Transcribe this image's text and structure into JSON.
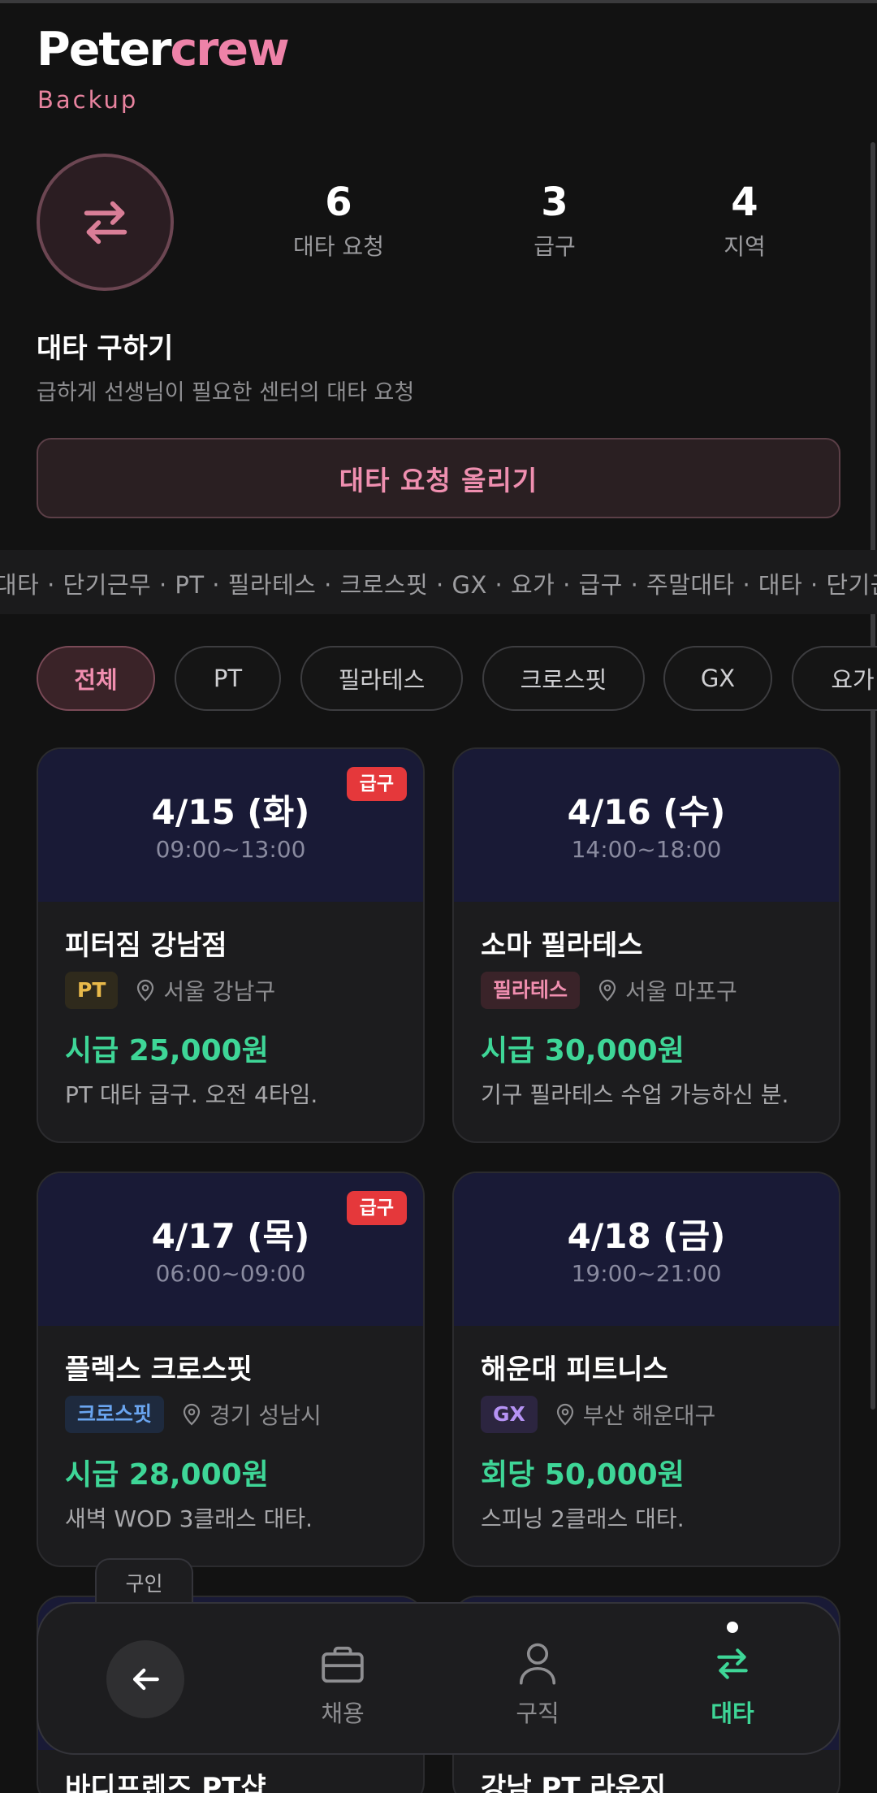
{
  "brand": {
    "part1": "Peter",
    "part2": "crew",
    "subtitle": "Backup"
  },
  "colors": {
    "accent_pink": "#ee82a8",
    "accent_green": "#3ed697",
    "urgent_red": "#e5383b",
    "card_header": "#191a36"
  },
  "stats": [
    {
      "value": "6",
      "label": "대타 요청"
    },
    {
      "value": "3",
      "label": "급구"
    },
    {
      "value": "4",
      "label": "지역"
    }
  ],
  "section": {
    "title": "대타 구하기",
    "description": "급하게 선생님이 필요한 센터의 대타 요청"
  },
  "cta_label": "대타 요청 올리기",
  "ticker_text": "대타 · 단기근무 · PT · 필라테스 · 크로스핏 · GX · 요가 · 급구 · 주말대타 · 대타 · 단기근무",
  "filters": [
    {
      "label": "전체",
      "active": true
    },
    {
      "label": "PT",
      "active": false
    },
    {
      "label": "필라테스",
      "active": false
    },
    {
      "label": "크로스핏",
      "active": false
    },
    {
      "label": "GX",
      "active": false
    },
    {
      "label": "요가",
      "active": false
    }
  ],
  "cards": [
    {
      "date": "4/15 (화)",
      "time": "09:00~13:00",
      "badge": "급구",
      "name": "피터짐 강남점",
      "tag": "PT",
      "location": "서울 강남구",
      "pay": "시급 25,000원",
      "desc": "PT 대타 급구. 오전 4타임."
    },
    {
      "date": "4/16 (수)",
      "time": "14:00~18:00",
      "badge": "",
      "name": "소마 필라테스",
      "tag": "필라테스",
      "location": "서울 마포구",
      "pay": "시급 30,000원",
      "desc": "기구 필라테스 수업 가능하신 분."
    },
    {
      "date": "4/17 (목)",
      "time": "06:00~09:00",
      "badge": "급구",
      "name": "플렉스 크로스핏",
      "tag": "크로스핏",
      "location": "경기 성남시",
      "pay": "시급 28,000원",
      "desc": "새벽 WOD 3클래스 대타."
    },
    {
      "date": "4/18 (금)",
      "time": "19:00~21:00",
      "badge": "",
      "name": "해운대 피트니스",
      "tag": "GX",
      "location": "부산 해운대구",
      "pay": "회당 50,000원",
      "desc": "스피닝 2클래스 대타."
    },
    {
      "name": "바디프렌즈 PT샵"
    },
    {
      "name": "강남 PT 라운지"
    }
  ],
  "bottom_nav": {
    "floating_tab": "구인",
    "items": [
      {
        "label": "채용",
        "icon": "briefcase-icon"
      },
      {
        "label": "구직",
        "icon": "person-icon"
      },
      {
        "label": "대타",
        "icon": "swap-icon",
        "active": true
      }
    ]
  }
}
